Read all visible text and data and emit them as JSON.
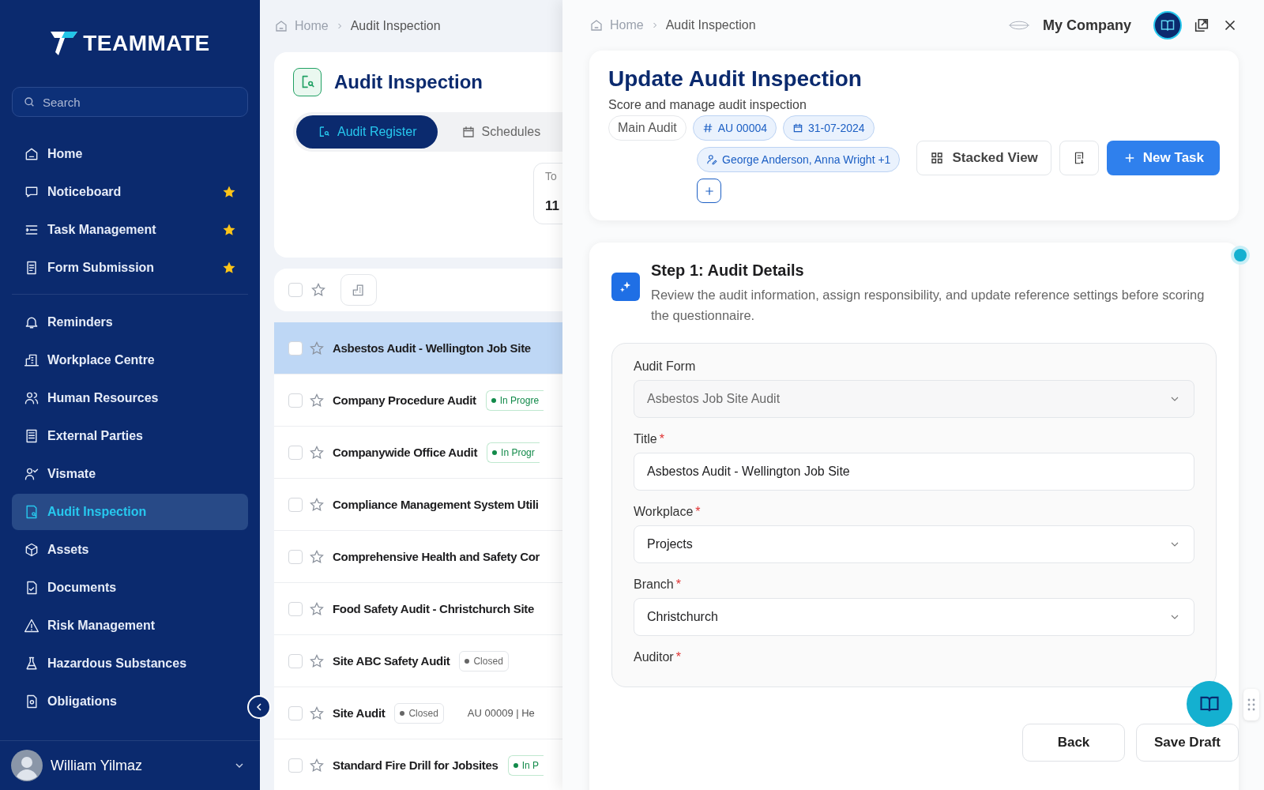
{
  "sidebar": {
    "logo": "TEAMMATE",
    "search": {
      "placeholder": "Search"
    },
    "pinned": [
      {
        "label": "Home",
        "starred": false,
        "selected": false
      },
      {
        "label": "Noticeboard",
        "starred": true,
        "selected": false
      },
      {
        "label": "Task Management",
        "starred": true,
        "selected": false
      },
      {
        "label": "Form Submission",
        "starred": true,
        "selected": false
      }
    ],
    "items": [
      {
        "label": "Reminders",
        "selected": false
      },
      {
        "label": "Workplace Centre",
        "selected": false
      },
      {
        "label": "Human Resources",
        "selected": false
      },
      {
        "label": "External Parties",
        "selected": false
      },
      {
        "label": "Vismate",
        "selected": false
      },
      {
        "label": "Audit Inspection",
        "selected": true
      },
      {
        "label": "Assets",
        "selected": false
      },
      {
        "label": "Documents",
        "selected": false
      },
      {
        "label": "Risk Management",
        "selected": false
      },
      {
        "label": "Hazardous Substances",
        "selected": false
      },
      {
        "label": "Obligations",
        "selected": false
      }
    ],
    "user": {
      "name": "William Yilmaz"
    }
  },
  "list_panel": {
    "breadcrumb": [
      "Home",
      "Audit Inspection"
    ],
    "title": "Audit Inspection",
    "tabs": [
      {
        "label": "Audit Register",
        "selected": true
      },
      {
        "label": "Schedules",
        "selected": false
      }
    ],
    "stat": {
      "label": "To",
      "value": "11"
    },
    "select_all": {
      "checked": false
    },
    "rows": [
      {
        "title": "Asbestos Audit - Wellington Job Site",
        "selected": true,
        "checked": false
      },
      {
        "title": "Company Procedure Audit",
        "selected": false,
        "checked": false,
        "status": {
          "kind": "in_progress",
          "label": "In Progre"
        }
      },
      {
        "title": "Companywide Office Audit",
        "selected": false,
        "checked": false,
        "status": {
          "kind": "in_progress",
          "label": "In Progr"
        }
      },
      {
        "title": "Compliance Management System Utili",
        "selected": false,
        "checked": false
      },
      {
        "title": "Comprehensive Health and Safety Cor",
        "selected": false,
        "checked": false
      },
      {
        "title": "Food Safety Audit - Christchurch Site",
        "selected": false,
        "checked": false
      },
      {
        "title": "Site ABC Safety Audit",
        "selected": false,
        "checked": false,
        "status": {
          "kind": "closed",
          "label": "Closed"
        }
      },
      {
        "title": "Site Audit",
        "selected": false,
        "checked": false,
        "status": {
          "kind": "closed",
          "label": "Closed"
        },
        "reference": "AU 00009 | He"
      },
      {
        "title": "Standard Fire Drill for Jobsites",
        "selected": false,
        "checked": false,
        "status": {
          "kind": "in_progress",
          "label": "In P"
        }
      }
    ]
  },
  "drawer": {
    "breadcrumb": [
      "Home",
      "Audit Inspection"
    ],
    "company": "My Company",
    "title": "Update Audit Inspection",
    "subtitle": "Score and manage audit inspection",
    "tags": [
      {
        "kind": "plain",
        "label": "Main Audit"
      },
      {
        "kind": "id",
        "label": "AU 00004"
      },
      {
        "kind": "date",
        "label": "31-07-2024"
      },
      {
        "kind": "people",
        "label": "George Anderson, Anna Wright +1"
      }
    ],
    "view_button": "Stacked View",
    "new_task_button": "New Task",
    "step": {
      "title": "Step 1: Audit Details",
      "description": "Review the audit information, assign responsibility, and update reference settings before scoring the questionnaire."
    },
    "fields": [
      {
        "label": "Audit Form",
        "kind": "select",
        "disabled": true,
        "value": "Asbestos Job Site Audit"
      },
      {
        "label": "Title",
        "required_mark": "*",
        "kind": "text",
        "disabled": false,
        "value": "Asbestos Audit - Wellington Job Site"
      },
      {
        "label": "Workplace",
        "required_mark": "*",
        "kind": "select",
        "disabled": false,
        "value": "Projects"
      },
      {
        "label": "Branch",
        "required_mark": "*",
        "kind": "select",
        "disabled": false,
        "value": "Christchurch"
      },
      {
        "label": "Auditor",
        "required_mark": "*"
      }
    ],
    "footer_buttons": [
      "Back",
      "Save Draft"
    ]
  }
}
